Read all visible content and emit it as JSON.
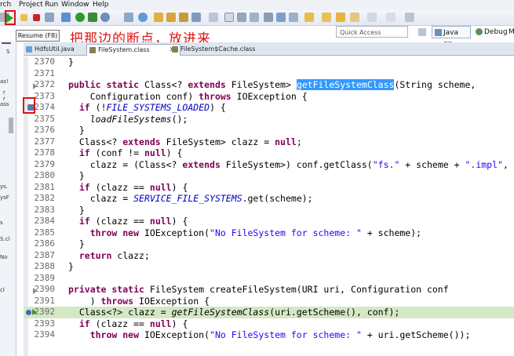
{
  "menu": [
    "rch",
    "Project",
    "Run",
    "Window",
    "Help"
  ],
  "tooltip": "Resume (F8)",
  "annotation": "把那边的断点，放进来",
  "quick_access": {
    "placeholder": "Quick Access"
  },
  "perspectives": {
    "java_ee": "Java EE",
    "debug": "Debug",
    "more": "M"
  },
  "left_fragments": [
    "S",
    "as!",
    "r",
    "r",
    "ass",
    "ys.",
    "ysF",
    "s",
    "S.cl",
    "No",
    "cl"
  ],
  "tabs": [
    {
      "label": "HdfsUtil.java"
    },
    {
      "label": "FileSystem.class"
    },
    {
      "label": "FileSystem$Cache.class"
    }
  ],
  "colors": {
    "accent": "#e01010",
    "current_line": "#d4e8c4",
    "selection": "#3399ff",
    "keyword": "#7f0055",
    "string": "#2a00ff"
  },
  "code_lines": [
    {
      "num": "2370",
      "text": "}"
    },
    {
      "num": "2371",
      "text": ""
    },
    {
      "num": "2372",
      "text": "public static Class<? extends FileSystem> getFileSystemClass(String scheme,"
    },
    {
      "num": "2373",
      "text": "    Configuration conf) throws IOException {"
    },
    {
      "num": "2374",
      "text": "  if (!FILE_SYSTEMS_LOADED) {"
    },
    {
      "num": "2375",
      "text": "    loadFileSystems();"
    },
    {
      "num": "2376",
      "text": "  }"
    },
    {
      "num": "2377",
      "text": "  Class<? extends FileSystem> clazz = null;"
    },
    {
      "num": "2378",
      "text": "  if (conf != null) {"
    },
    {
      "num": "2379",
      "text": "    clazz = (Class<? extends FileSystem>) conf.getClass(\"fs.\" + scheme + \".impl\", null"
    },
    {
      "num": "2380",
      "text": "  }"
    },
    {
      "num": "2381",
      "text": "  if (clazz == null) {"
    },
    {
      "num": "2382",
      "text": "    clazz = SERVICE_FILE_SYSTEMS.get(scheme);"
    },
    {
      "num": "2383",
      "text": "  }"
    },
    {
      "num": "2384",
      "text": "  if (clazz == null) {"
    },
    {
      "num": "2385",
      "text": "    throw new IOException(\"No FileSystem for scheme: \" + scheme);"
    },
    {
      "num": "2386",
      "text": "  }"
    },
    {
      "num": "2387",
      "text": "  return clazz;"
    },
    {
      "num": "2388",
      "text": "}"
    },
    {
      "num": "2389",
      "text": ""
    },
    {
      "num": "2390",
      "text": "private static FileSystem createFileSystem(URI uri, Configuration conf"
    },
    {
      "num": "2391",
      "text": "    ) throws IOException {"
    },
    {
      "num": "2392",
      "text": "  Class<?> clazz = getFileSystemClass(uri.getScheme(), conf);"
    },
    {
      "num": "2393",
      "text": "  if (clazz == null) {"
    },
    {
      "num": "2394",
      "text": "    throw new IOException(\"No FileSystem for scheme: \" + uri.getScheme());"
    }
  ]
}
